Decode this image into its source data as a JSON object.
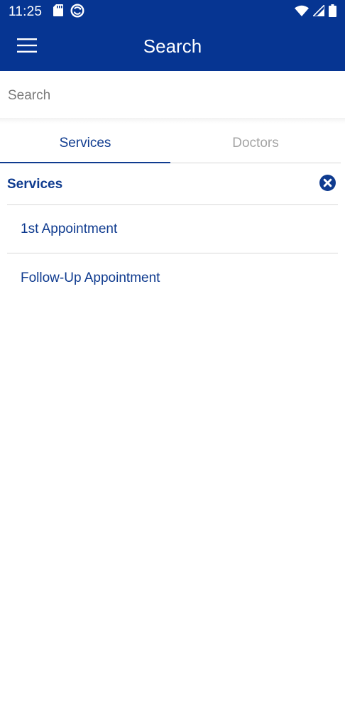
{
  "status_bar": {
    "time": "11:25",
    "left_icons": [
      "sd-card-icon",
      "sync-circle-icon"
    ],
    "right_icons": [
      "wifi-icon",
      "signal-icon",
      "battery-icon"
    ]
  },
  "app_bar": {
    "title": "Search",
    "menu_icon": "hamburger-menu-icon"
  },
  "search": {
    "placeholder": "Search",
    "value": ""
  },
  "tabs": [
    {
      "label": "Services",
      "active": true
    },
    {
      "label": "Doctors",
      "active": false
    }
  ],
  "section": {
    "title": "Services",
    "clear_icon": "close-circle-icon"
  },
  "items": [
    {
      "label": "1st Appointment"
    },
    {
      "label": "Follow-Up Appointment"
    }
  ],
  "colors": {
    "header_bg": "#063592",
    "accent": "#0f3b8f",
    "inactive_tab": "#a4a4a4",
    "divider": "#d8d8d8"
  }
}
